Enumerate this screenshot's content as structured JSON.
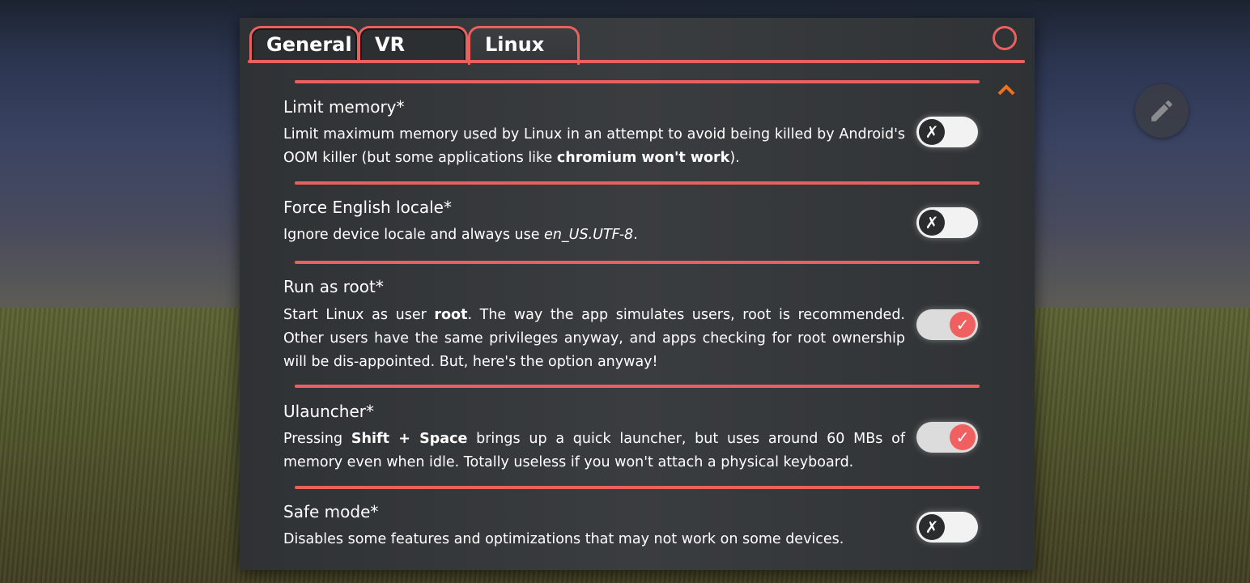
{
  "tabs": [
    {
      "label": "General"
    },
    {
      "label": "VR"
    },
    {
      "label": "Linux"
    }
  ],
  "settings": [
    {
      "title": "Limit memory*",
      "desc_parts": [
        "Limit maximum memory used by Linux in an attempt to avoid being killed by Android's OOM killer (but some applications like ",
        "chromium won't work",
        ")."
      ],
      "enabled": false
    },
    {
      "title": "Force English locale*",
      "desc_parts": [
        "Ignore device locale and always use ",
        "en_US.UTF-8",
        "."
      ],
      "enabled": false
    },
    {
      "title": "Run as root*",
      "desc_parts": [
        "Start Linux as user ",
        "root",
        ". The way the app simulates users, root is recommended. Other users have the same privileges anyway, and apps checking for root ownership will be dis-appointed. But, here's the option anyway!"
      ],
      "enabled": true
    },
    {
      "title": "Ulauncher*",
      "desc_parts": [
        "Pressing ",
        "Shift + Space",
        " brings up a quick launcher, but uses around 60 MBs of memory even when idle. Totally useless if you won't attach a physical keyboard."
      ],
      "enabled": true
    },
    {
      "title": "Safe mode*",
      "desc_parts": [
        "Disables some features and optimizations that may not work on some devices."
      ],
      "enabled": false
    }
  ],
  "toggle_glyphs": {
    "off": "✗",
    "on": "✓"
  },
  "colors": {
    "accent": "#e86060",
    "scroll_indicator": "#f07020"
  },
  "icons": {
    "close": "close-icon",
    "scroll_up": "chevron-up-icon",
    "edit": "pencil-icon"
  }
}
